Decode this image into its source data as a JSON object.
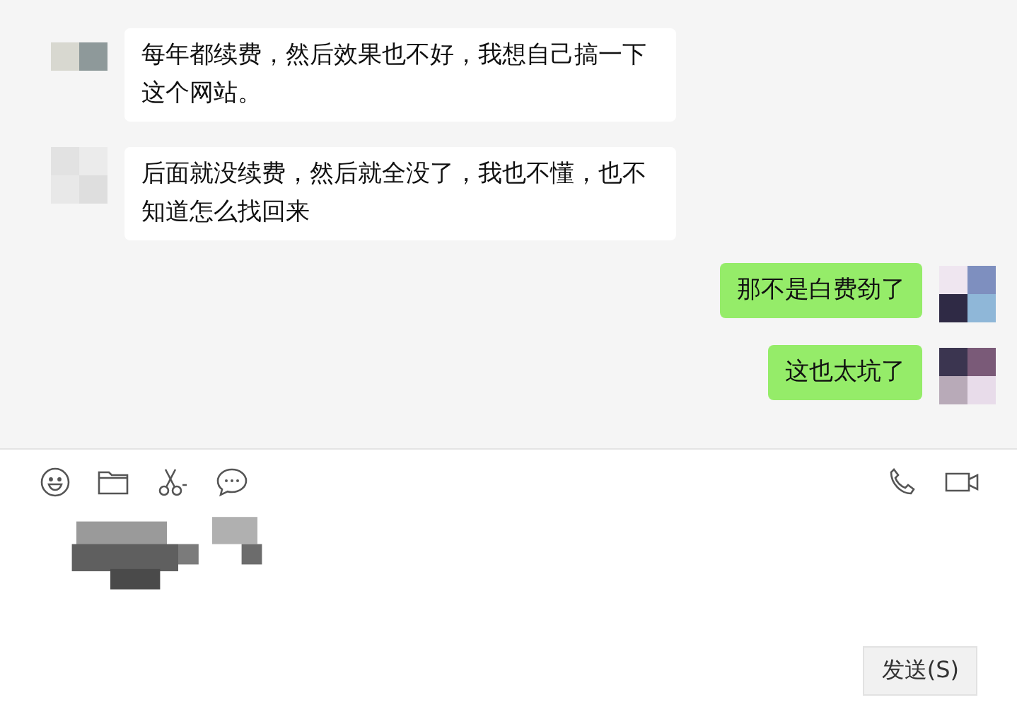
{
  "messages": [
    {
      "kind": "incoming",
      "text": "每年都续费，然后效果也不好，我想自己搞一下这个网站。"
    },
    {
      "kind": "incoming",
      "text": "后面就没续费，然后就全没了，我也不懂，也不知道怎么找回来"
    },
    {
      "kind": "outgoing",
      "text": "那不是白费劲了"
    },
    {
      "kind": "outgoing",
      "text": "这也太坑了"
    }
  ],
  "send_button": "发送(S)"
}
